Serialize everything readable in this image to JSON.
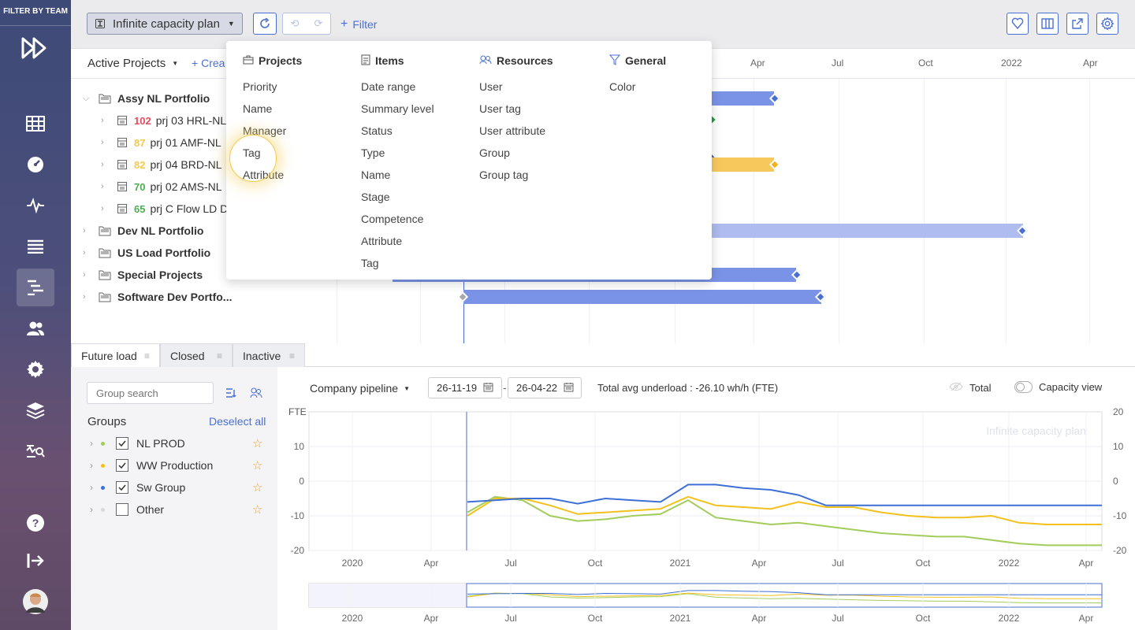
{
  "sidebar": {
    "filter_title": "FILTER BY TEAM"
  },
  "topbar": {
    "plan_label": "Infinite capacity plan",
    "filter_label": "Filter"
  },
  "gantt": {
    "view_label": "Active Projects",
    "create_label": "Crea",
    "timeline": [
      "Apr",
      "Jul",
      "Oct",
      "2022",
      "Apr"
    ],
    "rows": [
      {
        "label": "Assy NL Portfolio",
        "bold": true
      },
      {
        "num": "102",
        "label": "prj 03 HRL-NL",
        "color": "#e94a5c"
      },
      {
        "num": "87",
        "label": "prj 01 AMF-NL",
        "color": "#f2c94c"
      },
      {
        "num": "82",
        "label": "prj 04 BRD-NL",
        "color": "#f2c94c"
      },
      {
        "num": "70",
        "label": "prj 02 AMS-NL",
        "color": "#4caf50"
      },
      {
        "num": "65",
        "label": "prj C Flow LD DI",
        "color": "#4caf50"
      },
      {
        "label": "Dev NL Portfolio",
        "bold": true
      },
      {
        "label": "US Load Portfolio",
        "bold": true
      },
      {
        "label": "Special Projects",
        "bold": true
      },
      {
        "label": "Software Dev Portfo...",
        "bold": true
      }
    ]
  },
  "dropdown": {
    "projects": {
      "title": "Projects",
      "items": [
        "Priority",
        "Name",
        "Manager",
        "Tag",
        "Attribute"
      ]
    },
    "items": {
      "title": "Items",
      "items": [
        "Date range",
        "Summary level",
        "Status",
        "Type",
        "Name",
        "Stage",
        "Competence",
        "Attribute",
        "Tag"
      ]
    },
    "resources": {
      "title": "Resources",
      "items": [
        "User",
        "User tag",
        "User attribute",
        "Group",
        "Group tag"
      ]
    },
    "general": {
      "title": "General",
      "items": [
        "Color"
      ]
    }
  },
  "tabs": [
    "Future load",
    "Closed",
    "Inactive"
  ],
  "left_panel": {
    "search_placeholder": "Group search",
    "groups_title": "Groups",
    "deselect_label": "Deselect all",
    "groups": [
      {
        "name": "NL PROD",
        "checked": true,
        "dot": "#a3cc5c"
      },
      {
        "name": "WW Production",
        "checked": true,
        "dot": "#f2c11c"
      },
      {
        "name": "Sw Group",
        "checked": true,
        "dot": "#3d6fd6"
      },
      {
        "name": "Other",
        "checked": false,
        "dot": "#d8d8d8"
      }
    ]
  },
  "chart_header": {
    "pipeline": "Company pipeline",
    "date_from": "26-11-19",
    "date_to": "26-04-22",
    "summary": "Total avg underload : -26.10 wh/h (FTE)",
    "total_label": "Total",
    "capacity_label": "Capacity view"
  },
  "chart_data": {
    "type": "line",
    "ylabel": "FTE",
    "watermark": "Infinite capacity plan",
    "ylim": [
      -20,
      20
    ],
    "yticks": [
      10,
      0,
      -10,
      -20
    ],
    "xticks": [
      "2020",
      "Apr",
      "Jul",
      "Oct",
      "2021",
      "Apr",
      "Jul",
      "Oct",
      "2022",
      "Apr"
    ],
    "x": [
      "2020-05",
      "2020-06",
      "2020-07",
      "2020-08",
      "2020-09",
      "2020-10",
      "2020-11",
      "2020-12",
      "2021-01",
      "2021-02",
      "2021-03",
      "2021-04",
      "2021-05",
      "2021-06",
      "2021-07",
      "2021-08",
      "2021-09",
      "2021-10",
      "2021-11",
      "2021-12",
      "2022-01",
      "2022-02",
      "2022-03",
      "2022-04"
    ],
    "series": [
      {
        "color": "#3d6fd6",
        "values": [
          -6,
          -5.5,
          -5,
          -5,
          -6.5,
          -5,
          -5.5,
          -6,
          -1,
          -1,
          -2,
          -2.5,
          -4,
          -7,
          -7,
          -7,
          -7,
          -7,
          -7,
          -7,
          -7,
          -7,
          -7,
          -7
        ]
      },
      {
        "color": "#f2c11c",
        "values": [
          -10,
          -5,
          -5,
          -7,
          -9.5,
          -9,
          -8.5,
          -8,
          -4.5,
          -7,
          -7.5,
          -8,
          -6,
          -7.5,
          -7.5,
          -9,
          -10,
          -10.5,
          -10.5,
          -10,
          -12,
          -12.5,
          -12.5,
          -12.5
        ]
      },
      {
        "color": "#a3cc5c",
        "values": [
          -9,
          -4.5,
          -5.5,
          -10,
          -11.5,
          -11,
          -10,
          -9.5,
          -5.5,
          -10.5,
          -11.5,
          -12.5,
          -12,
          -13,
          -14,
          -15,
          -15.5,
          -16,
          -16,
          -17,
          -18,
          -18.5,
          -18.5,
          -18.5
        ]
      }
    ]
  }
}
